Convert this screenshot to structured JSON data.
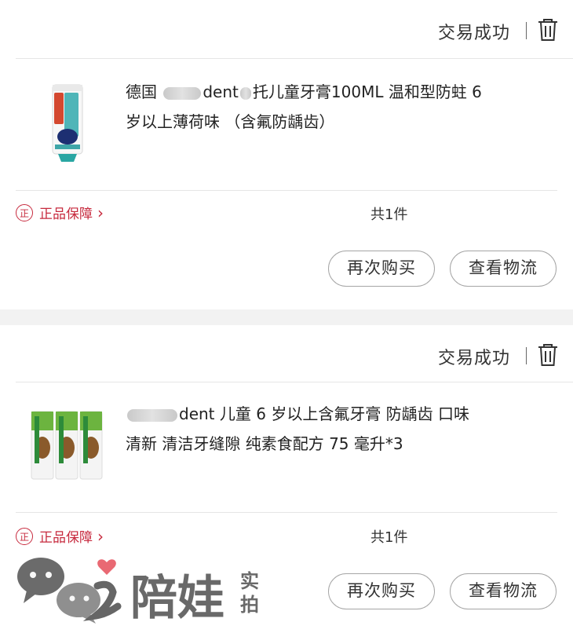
{
  "orders": [
    {
      "status": "交易成功",
      "title_prefix": "德国",
      "title_mid": "dent",
      "title_rest": "托儿童牙膏100ML 温和型防蛀 6 岁以上薄荷味 （含氟防龋齿）",
      "guarantee": "正品保障",
      "count": "共1件",
      "rebuy": "再次购买",
      "logistics": "查看物流"
    },
    {
      "status": "交易成功",
      "title_mid": "dent",
      "title_rest": " 儿童 6 岁以上含氟牙膏 防龋齿 口味清新 清洁牙缝隙 纯素食配方 75 毫升*3",
      "guarantee": "正品保障",
      "count": "共1件",
      "rebuy": "再次购买",
      "logistics": "查看物流"
    }
  ],
  "badge_glyph": "正",
  "watermark": {
    "text": "陪娃",
    "side_text": "实拍"
  },
  "colors": {
    "accent": "#c72a3e",
    "border": "#a5a5a5",
    "divider": "#e6e6e6",
    "page_bg": "#f2f2f2"
  }
}
